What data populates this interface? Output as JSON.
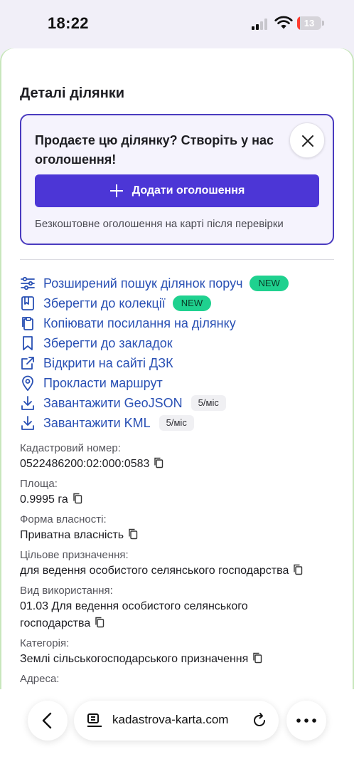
{
  "status_bar": {
    "time": "18:22",
    "battery_level": "13"
  },
  "section_title": "Деталі ділянки",
  "promo": {
    "text": "Продаєте цю ділянку? Створіть у нас оголошення!",
    "button_label": "Додати оголошення",
    "note": "Безкоштовне оголошення на карті після перевірки"
  },
  "actions": [
    {
      "label": "Розширений пошук ділянок поруч",
      "badge": "NEW",
      "icon": "sliders-icon"
    },
    {
      "label": "Зберегти до колекції",
      "badge": "NEW",
      "icon": "book-icon"
    },
    {
      "label": "Копіювати посилання на ділянку",
      "icon": "clipboard-icon"
    },
    {
      "label": "Зберегти до закладок",
      "icon": "bookmark-icon"
    },
    {
      "label": "Відкрити на сайті ДЗК",
      "icon": "external-link-icon"
    },
    {
      "label": "Прокласти маршрут",
      "icon": "map-pin-icon"
    },
    {
      "label": "Завантажити GeoJSON",
      "limit": "5/міс",
      "icon": "download-icon"
    },
    {
      "label": "Завантажити KML",
      "limit": "5/міс",
      "icon": "download-icon"
    }
  ],
  "properties": [
    {
      "label": "Кадастровий номер:",
      "value": "0522486200:02:000:0583"
    },
    {
      "label": "Площа:",
      "value": "0.9995 га"
    },
    {
      "label": "Форма власності:",
      "value": "Приватна власність"
    },
    {
      "label": "Цільове призначення:",
      "value": "для ведення особистого селянського господарства"
    },
    {
      "label": "Вид використання:",
      "value": "01.03 Для ведення особистого селянського господарства"
    },
    {
      "label": "Категорія:",
      "value": "Землі сільськогосподарського призначення"
    },
    {
      "label": "Адреса:",
      "value": ""
    }
  ],
  "browser": {
    "host": "kadastrova-karta.com"
  },
  "colors": {
    "accent": "#4c36d6",
    "link": "#2950b4",
    "badge_new": "#1fd18f"
  }
}
